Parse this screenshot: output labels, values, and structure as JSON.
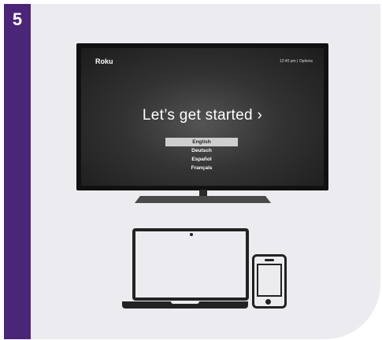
{
  "step": {
    "number": "5"
  },
  "tv": {
    "logo": "Roku",
    "status": "12:40 pm  |  Options",
    "headline": "Let’s get started ›",
    "languages": [
      "English",
      "Deutsch",
      "Español",
      "Français"
    ],
    "selected_language": "English"
  },
  "colors": {
    "stripe": "#4b2578",
    "card": "#ececf0",
    "screen": "#111111"
  },
  "icons": [
    "tv-icon",
    "laptop-icon",
    "phone-icon"
  ]
}
